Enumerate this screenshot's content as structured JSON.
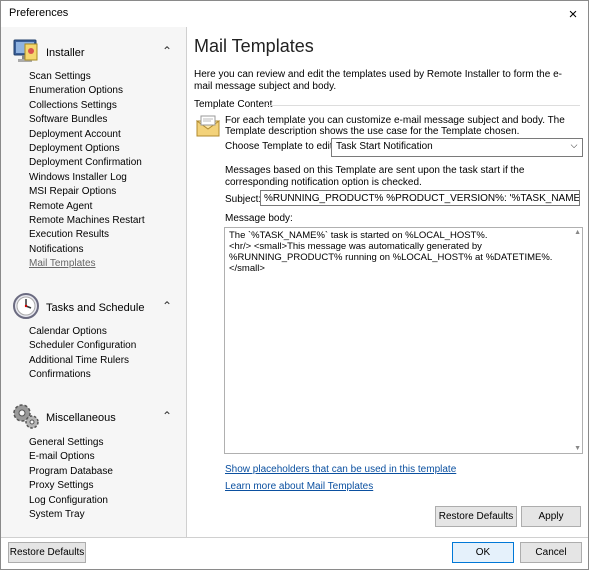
{
  "window": {
    "title": "Preferences",
    "close_icon": "×"
  },
  "sidebar": {
    "groups": [
      {
        "title": "Installer",
        "items": [
          "Scan Settings",
          "Enumeration Options",
          "Collections Settings",
          "Software Bundles",
          "Deployment Account",
          "Deployment Options",
          "Deployment Confirmation",
          "Windows Installer Log",
          "MSI Repair Options",
          "Remote Agent",
          "Remote Machines Restart",
          "Execution Results",
          "Notifications",
          "Mail Templates"
        ]
      },
      {
        "title": "Tasks and Schedule",
        "items": [
          "Calendar Options",
          "Scheduler Configuration",
          "Additional Time Rulers",
          "Confirmations"
        ]
      },
      {
        "title": "Miscellaneous",
        "items": [
          "General Settings",
          "E-mail Options",
          "Program Database",
          "Proxy Settings",
          "Log Configuration",
          "System Tray"
        ]
      }
    ],
    "chevron": "⌃",
    "active_item": "Mail Templates"
  },
  "main": {
    "title": "Mail Templates",
    "description": "Here you can review and edit the templates used by Remote Installer to form the e-mail message subject and body.",
    "section": "Template Content",
    "template_desc": "For each template you can customize e-mail message subject and body. The Template description shows the use case for the Template chosen.",
    "choose_label": "Choose Template to edit:",
    "template_selected": "Task Start Notification",
    "dropdown_arrow": "⌵",
    "messages_text": "Messages based on this Template are sent upon the task start if the corresponding notification option is checked.",
    "subject_label": "Subject:",
    "subject_value": "%RUNNING_PRODUCT% %PRODUCT_VERSION%: '%TASK_NAME%' task is started",
    "body_label": "Message body:",
    "body_line1": "The `%TASK_NAME%` task is started on %LOCAL_HOST%.",
    "body_line2": "<hr/> <small>This message was automatically generated by",
    "body_line3": "%RUNNING_PRODUCT% running on %LOCAL_HOST% at %DATETIME%.</small>",
    "scroll_up": "▲",
    "scroll_down": "▼",
    "link_placeholders": "Show placeholders that can be used in this template",
    "link_learn": "Learn more about Mail Templates",
    "restore_defaults_btn": "Restore Defaults",
    "apply_btn": "Apply"
  },
  "footer": {
    "restore_defaults": "Restore Defaults",
    "ok": "OK",
    "cancel": "Cancel"
  }
}
